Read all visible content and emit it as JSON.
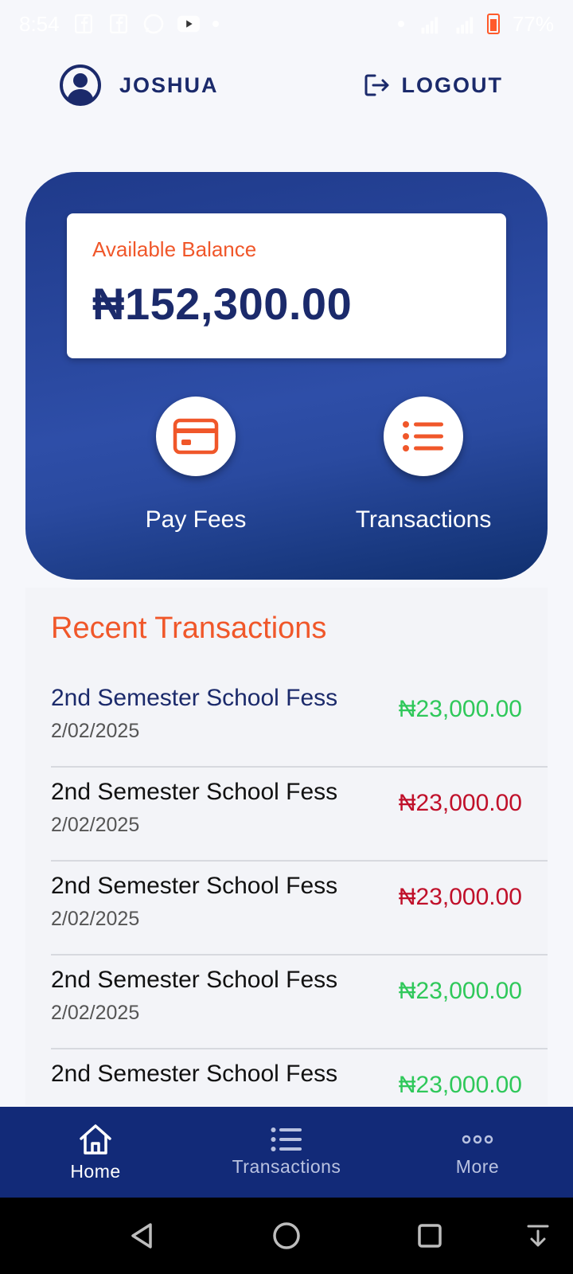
{
  "status_bar": {
    "time": "8:54",
    "battery": "77%"
  },
  "header": {
    "username": "JOSHUA",
    "logout_label": "LOGOUT"
  },
  "balance": {
    "label": "Available Balance",
    "value": "₦152,300.00"
  },
  "actions": [
    {
      "label": "Pay Fees",
      "icon": "credit-card-icon"
    },
    {
      "label": "Transactions",
      "icon": "list-icon"
    }
  ],
  "recent": {
    "title": "Recent Transactions",
    "items": [
      {
        "title": "2nd Semester School Fess",
        "date": "2/02/2025",
        "amount": "₦23,000.00",
        "type": "credit"
      },
      {
        "title": "2nd Semester School Fess",
        "date": "2/02/2025",
        "amount": "₦23,000.00",
        "type": "debit"
      },
      {
        "title": "2nd Semester School Fess",
        "date": "2/02/2025",
        "amount": "₦23,000.00",
        "type": "debit"
      },
      {
        "title": "2nd Semester School Fess",
        "date": "2/02/2025",
        "amount": "₦23,000.00",
        "type": "credit"
      },
      {
        "title": "2nd Semester School Fess",
        "date": "",
        "amount": "₦23,000.00",
        "type": "credit"
      }
    ]
  },
  "bottom_nav": [
    {
      "label": "Home",
      "icon": "home-icon",
      "active": true
    },
    {
      "label": "Transactions",
      "icon": "list-icon",
      "active": false
    },
    {
      "label": "More",
      "icon": "more-dots-icon",
      "active": false
    }
  ],
  "colors": {
    "primary": "#1b2a6b",
    "accent": "#f0572a",
    "credit": "#2fc85a",
    "debit": "#c0102a",
    "nav_bg": "#122a78"
  }
}
